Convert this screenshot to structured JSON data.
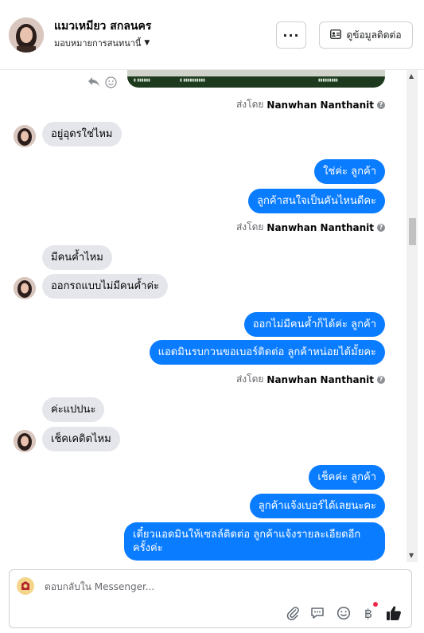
{
  "header": {
    "contact_name": "แมวเหมียว สกลนคร",
    "assign_label": "มอบหมายการสนทนานี้",
    "more_label": "···",
    "view_contact_label": "ดูข้อมูลติดต่อ"
  },
  "sent_by": {
    "prefix": "ส่งโดย",
    "name": "Nanwhan Nanthanit"
  },
  "messages": [
    {
      "dir": "in",
      "text": "อยู่อุดรใช่ไหม"
    },
    {
      "dir": "out",
      "text": "ใช่ค่ะ ลูกค้า"
    },
    {
      "dir": "out",
      "text": "ลูกค้าสนใจเป็นคันไหนดีคะ"
    },
    {
      "dir": "in",
      "text": "มีคนค้ำไหม"
    },
    {
      "dir": "in",
      "text": "ออกรถแบบไม่มีคนค้ำค่ะ"
    },
    {
      "dir": "out",
      "text": "ออกไม่มีคนค้ำก็ได้ค่ะ ลูกค้า"
    },
    {
      "dir": "out",
      "text": "แอดมินรบกวนขอเบอร์ติดต่อ ลูกค้าหน่อยได้มั้ยคะ"
    },
    {
      "dir": "in",
      "text": "ค่ะแปปนะ"
    },
    {
      "dir": "in",
      "text": "เช็คเคดิตไหม"
    },
    {
      "dir": "out",
      "text": "เช็คค่ะ ลูกค้า"
    },
    {
      "dir": "out",
      "text": "ลูกค้าแจ้งเบอร์ได้เลยนะคะ"
    },
    {
      "dir": "out",
      "text": "เดี๋ยวแอดมินให้เซลล์ติดต่อ ลูกค้าแจ้งรายละเอียดอีกครั้งค่ะ"
    }
  ],
  "composer": {
    "placeholder": "ตอบกลับใน Messenger..."
  },
  "colors": {
    "outgoing_bubble": "#0a7cff",
    "incoming_bubble": "#e4e6eb",
    "notification_dot": "#f02849"
  },
  "icons": [
    "reply-icon",
    "emoji-react-icon",
    "info-icon",
    "contact-card-icon",
    "chevron-down-icon",
    "attach-icon",
    "saved-reply-icon",
    "emoji-icon",
    "payment-icon",
    "like-icon"
  ]
}
